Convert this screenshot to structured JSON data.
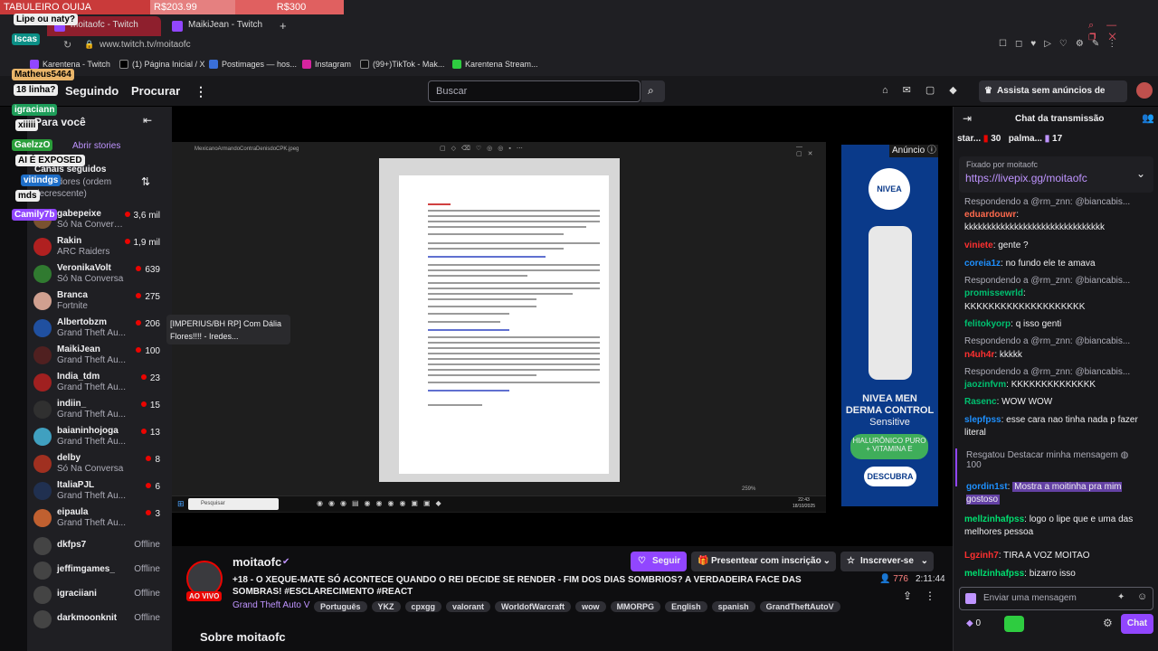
{
  "overlay": {
    "strip": [
      "TABULEIRO OUIJA",
      "R$203.99",
      "R$300"
    ],
    "stickers": [
      "Lipe ou naty?",
      "Iscas",
      "Matheus5464",
      "18 linha?",
      "igraciann",
      "xiiiii",
      "GaelzzO",
      "AI É EXPOSED",
      "vitindgs",
      "mds",
      "Camily7b"
    ]
  },
  "browser": {
    "tabs": [
      "moitaofc - Twitch",
      "MaikiJean - Twitch"
    ],
    "url": "www.twitch.tv/moitaofc",
    "bookmarks": [
      "Karentena - Twitch",
      "(1) Página Inicial / X",
      "Postimages — hos...",
      "Instagram",
      "(99+)TikTok - Mak...",
      "Karentena Stream..."
    ]
  },
  "nav": {
    "following": "Seguindo",
    "browse": "Procurar",
    "search_placeholder": "Buscar",
    "promo": "Assista sem anúncios de graça"
  },
  "sidebar": {
    "title": "Para você",
    "stories": "Abrir stories",
    "followed": "Canais seguidos",
    "sort": "Seguidores (ordem decrescente)",
    "channels": [
      {
        "name": "gabepeixe",
        "game": "Só Na Convers...",
        "viewers": "3,6 mil",
        "color": "#7a5230"
      },
      {
        "name": "Rakin",
        "game": "ARC Raiders",
        "viewers": "1,9 mil",
        "color": "#b02020"
      },
      {
        "name": "VeronikaVolt",
        "game": "Só Na Conversa",
        "viewers": "639",
        "color": "#307a30"
      },
      {
        "name": "Branca",
        "game": "Fortnite",
        "viewers": "275",
        "color": "#d0a090"
      },
      {
        "name": "Albertobzm",
        "game": "Grand Theft Au...",
        "viewers": "206",
        "color": "#2050a0"
      },
      {
        "name": "MaikiJean",
        "game": "Grand Theft Au...",
        "viewers": "100",
        "color": "#502020"
      },
      {
        "name": "India_tdm",
        "game": "Grand Theft Au...",
        "viewers": "23",
        "color": "#a02020"
      },
      {
        "name": "indiin_",
        "game": "Grand Theft Au...",
        "viewers": "15",
        "color": "#303030"
      },
      {
        "name": "baianinhojoga",
        "game": "Grand Theft Au...",
        "viewers": "13",
        "color": "#40a0c0"
      },
      {
        "name": "delby",
        "game": "Só Na Conversa",
        "viewers": "8",
        "color": "#a03020"
      },
      {
        "name": "ItaliaPJL",
        "game": "Grand Theft Au...",
        "viewers": "6",
        "color": "#203050"
      },
      {
        "name": "eipaula",
        "game": "Grand Theft Au...",
        "viewers": "3",
        "color": "#c06030"
      }
    ],
    "offline": [
      {
        "name": "dkfps7",
        "status": "Offline"
      },
      {
        "name": "jeffimgames_",
        "status": "Offline"
      },
      {
        "name": "igraciiani",
        "status": "Offline"
      },
      {
        "name": "darkmoonknit",
        "status": "Offline"
      }
    ]
  },
  "video": {
    "tooltip": "[IMPERIUS/BH RP] Com Dália Flores!!!! - Iredes...",
    "ad_label": "Anúncio",
    "ad": {
      "brand": "NIVEA",
      "line1": "NIVEA MEN",
      "line2": "DERMA CONTROL",
      "line3": "Sensitive",
      "pill": "HIALURÔNICO PURO + VITAMINA E",
      "cta": "DESCUBRA"
    },
    "taskbar_search": "Pesquisar",
    "zoom": "259%",
    "clock": "22:43",
    "date": "18/10/2025",
    "file": "MexicanoArmandoContraDenisdoCPK.jpeg"
  },
  "stream": {
    "channel": "moitaofc",
    "live": "AO VIVO",
    "follow": "Seguir",
    "gift": "Presentear com inscrição",
    "subscribe": "Inscrever-se",
    "title": "+18 - O XEQUE-MATE SÓ ACONTECE QUANDO O REI DECIDE SE RENDER - FIM DOS DIAS SOMBRIOS? A VERDADEIRA FACE DAS SOMBRAS! #ESCLARECIMENTO #REACT",
    "game": "Grand Theft Auto V",
    "viewers": "776",
    "uptime": "2:11:44",
    "tags": [
      "Português",
      "YKZ",
      "cpxgg",
      "valorant",
      "WorldofWarcraft",
      "wow",
      "MMORPG",
      "English",
      "spanish",
      "GrandTheftAutoV"
    ],
    "about": "Sobre moitaofc"
  },
  "chat": {
    "title": "Chat da transmissão",
    "top": [
      {
        "name": "star...",
        "count": "30"
      },
      {
        "name": "palma...",
        "count": "17"
      }
    ],
    "pinned_by": "Fixado por moitaofc",
    "pinned_link": "https://livepix.gg/moitaofc",
    "messages": [
      {
        "reply": "Respondendo a @rm_znn: @biancabis..."
      },
      {
        "user": "eduardouwr",
        "color": "#ff6a4d",
        "text": "kkkkkkkkkkkkkkkkkkkkkkkkkkkkkkk"
      },
      {
        "user": "viniete",
        "color": "#ff3030",
        "text": "gente ?"
      },
      {
        "user": "coreia1z",
        "color": "#1e90ff",
        "text": "no fundo ele te amava"
      },
      {
        "reply": "Respondendo a @rm_znn: @biancabis..."
      },
      {
        "user": "promissewrld",
        "color": "#00c070",
        "text": ""
      },
      {
        "user": "",
        "color": "#efeff1",
        "text": "KKKKKKKKKKKKKKKKKKKK"
      },
      {
        "user": "felitokyorp",
        "color": "#00c070",
        "text": "q isso genti"
      },
      {
        "reply": "Respondendo a @rm_znn: @biancabis..."
      },
      {
        "user": "n4uh4r",
        "color": "#ff3030",
        "text": "kkkkk"
      },
      {
        "reply": "Respondendo a @rm_znn: @biancabis..."
      },
      {
        "user": "jaozinfvm",
        "color": "#00c070",
        "text": "KKKKKKKKKKKKKK"
      },
      {
        "user": "Rasenc",
        "color": "#00c070",
        "text": "WOW WOW"
      },
      {
        "user": "slepfpss",
        "color": "#1e90ff",
        "text": "esse cara nao tinha nada p fazer literal"
      }
    ],
    "redeem": "Resgatou Destacar minha mensagem",
    "redeem_cost": "100",
    "highlight_user": "gordin1st",
    "highlight_text": "Mostra a moitinha pra mim gostoso",
    "after": [
      {
        "user": "mellzinhafpss",
        "color": "#00e070",
        "text": "logo o lipe que e uma das melhores pessoa"
      },
      {
        "user": "Lgzinh7",
        "color": "#ff3030",
        "text": "TIRA A VOZ MOITAO"
      },
      {
        "user": "mellzinhafpss",
        "color": "#00e070",
        "text": "bizarro isso"
      }
    ],
    "input_placeholder": "Enviar uma mensagem",
    "points": "0",
    "send": "Chat"
  }
}
